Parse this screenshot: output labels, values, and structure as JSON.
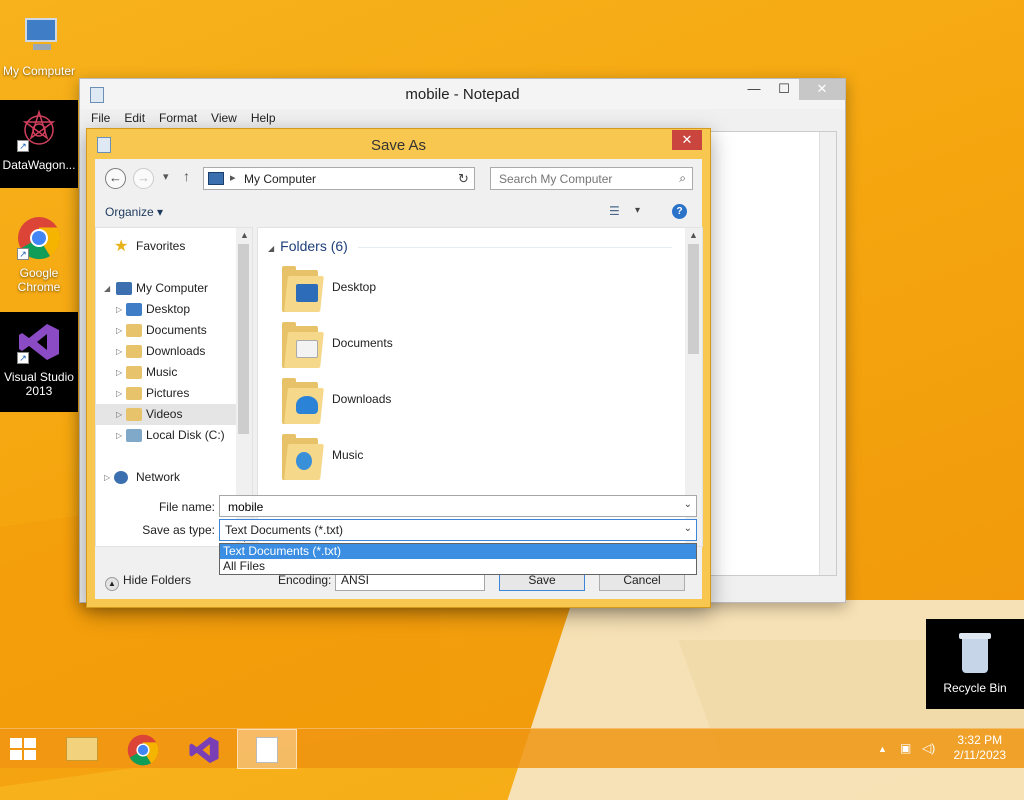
{
  "desktop": {
    "icons": [
      {
        "label": "My Computer"
      },
      {
        "label": "DataWagon..."
      },
      {
        "label": "Google Chrome"
      },
      {
        "label": "Visual Studio 2013"
      },
      {
        "label": "Recycle Bin"
      }
    ]
  },
  "notepad": {
    "title": "mobile - Notepad",
    "menu": [
      "File",
      "Edit",
      "Format",
      "View",
      "Help"
    ],
    "controls": {
      "minimize": "—",
      "maximize": "☐",
      "close": "✕"
    }
  },
  "saveas": {
    "title": "Save As",
    "close": "✕",
    "address": "My Computer",
    "search_placeholder": "Search My Computer",
    "organize": "Organize",
    "nav": {
      "favorites": "Favorites",
      "my_computer": "My Computer",
      "items": [
        "Desktop",
        "Documents",
        "Downloads",
        "Music",
        "Pictures",
        "Videos",
        "Local Disk (C:)"
      ],
      "network": "Network"
    },
    "group_header": "Folders (6)",
    "folders": [
      "Desktop",
      "Documents",
      "Downloads",
      "Music"
    ],
    "file_name_label": "File name:",
    "file_name_value": "mobile",
    "save_type_label": "Save as type:",
    "save_type_value": "Text Documents (*.txt)",
    "save_type_options": [
      "Text Documents (*.txt)",
      "All Files"
    ],
    "hide_folders": "Hide Folders",
    "encoding_label": "Encoding:",
    "encoding_value": "ANSI",
    "save_button": "Save",
    "cancel_button": "Cancel"
  },
  "taskbar": {
    "clock_time": "3:32 PM",
    "clock_date": "2/11/2023"
  }
}
